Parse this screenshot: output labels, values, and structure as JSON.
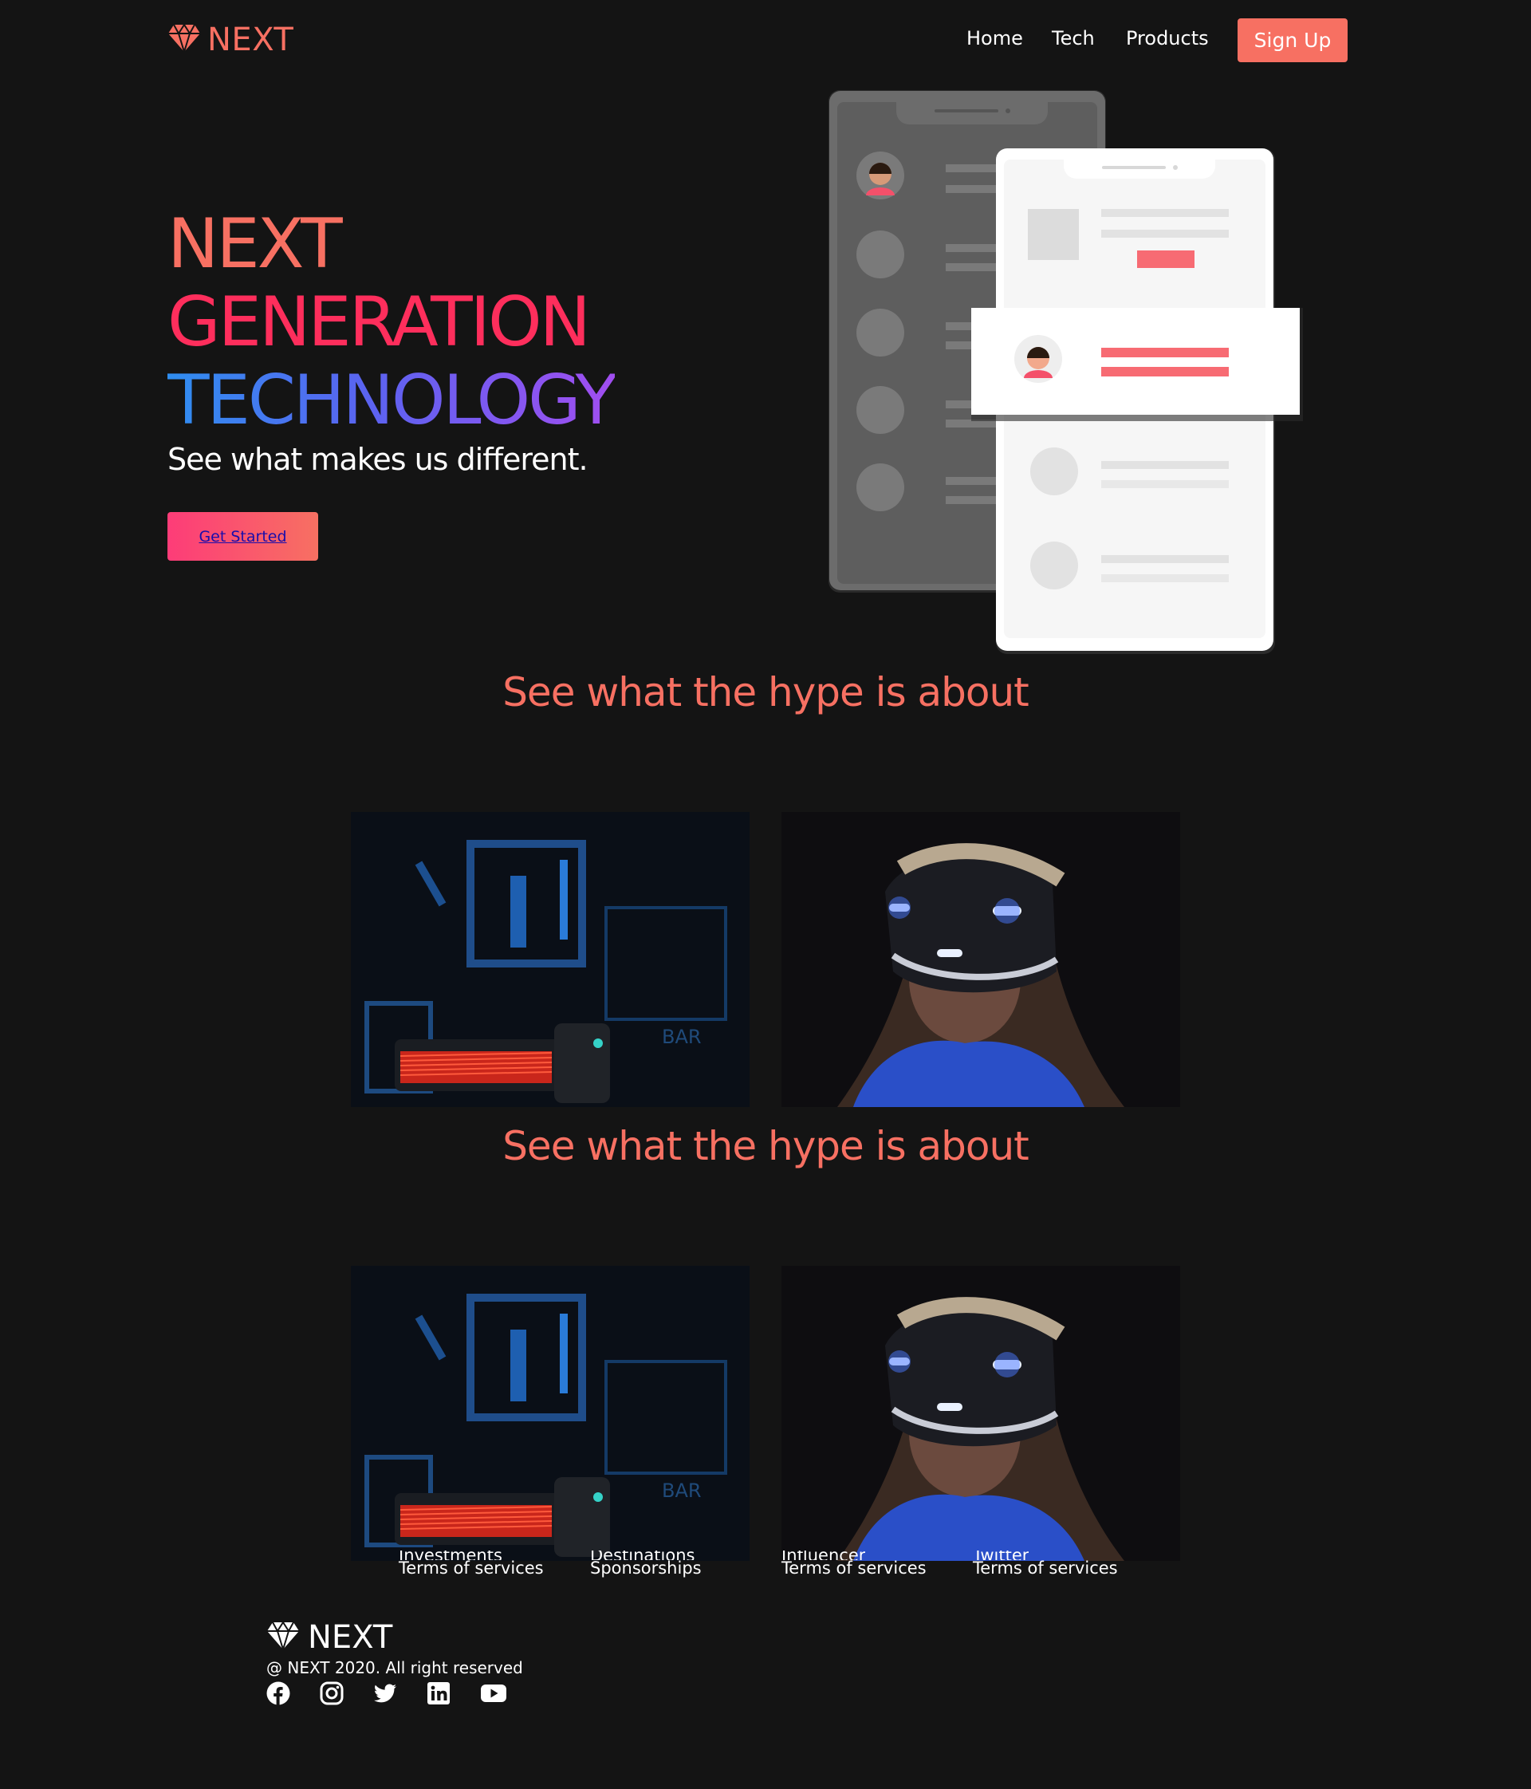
{
  "brand": {
    "name": "NEXT",
    "color": "#f77062"
  },
  "nav": {
    "links": [
      "Home",
      "Tech",
      "Products"
    ],
    "signup_label": "Sign Up"
  },
  "hero": {
    "line1": "NEXT",
    "line2": "GENERATION",
    "line3": "TECHNOLOGY",
    "subtitle": "See what makes us different.",
    "cta_label": "Get Started"
  },
  "sections": [
    {
      "title": "See what the hype is about"
    },
    {
      "title": "See what the hype is about"
    }
  ],
  "footer": {
    "clipped_headings": [
      "Investments",
      "Destinations",
      "Influencer",
      "Twitter"
    ],
    "links": [
      "Terms of services",
      "Sponsorships",
      "Terms of services",
      "Terms of services"
    ],
    "brand": "NEXT",
    "copyright": "@ NEXT 2020. All right reserved",
    "social_icons": [
      "facebook-icon",
      "instagram-icon",
      "twitter-icon",
      "linkedin-icon",
      "youtube-icon"
    ]
  },
  "colors": {
    "background": "#141414",
    "accent": "#f77062",
    "pink": "#fe2e5c",
    "gradient_blue": "#2f8ef0",
    "gradient_purple": "#a14ef0"
  }
}
